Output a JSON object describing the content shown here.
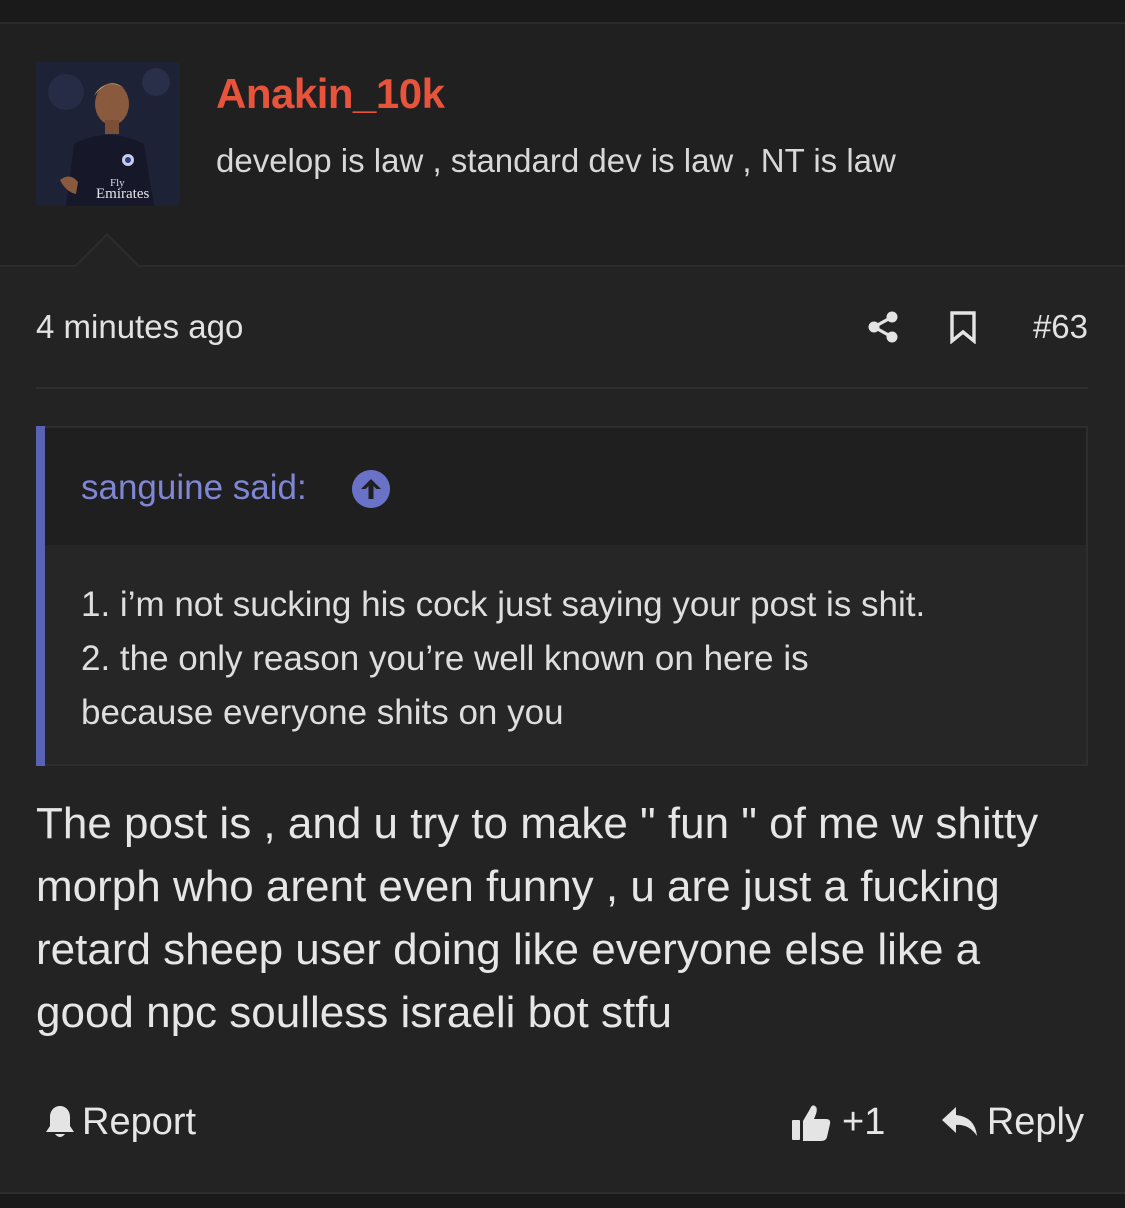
{
  "user": {
    "username": "Anakin_10k",
    "title": "develop is law , standard dev is law , NT is law",
    "avatar_icon": "user-avatar-photo",
    "username_color": "#e8533c"
  },
  "meta": {
    "timestamp": "4 minutes ago",
    "post_number": "#63",
    "share_icon": "share-icon",
    "bookmark_icon": "bookmark-icon"
  },
  "quote": {
    "author": "sanguine said:",
    "jump_icon": "arrow-up-circle-icon",
    "lines": [
      "1. i’m not sucking his cock just saying your post is shit.",
      "2. the only reason you’re well known on here is",
      "because everyone shits on you"
    ],
    "accent_color": "#5a62b4"
  },
  "post": {
    "lines": [
      "The post is , and u try to make \" fun \" of me w shitty",
      "morph who arent even funny , u are just a fucking",
      "retard sheep user doing like everyone else like a",
      "good npc soulless israeli bot stfu"
    ]
  },
  "actions": {
    "report_label": "Report",
    "report_icon": "bell-icon",
    "like_count": "+1",
    "like_icon": "thumbs-up-icon",
    "reply_label": "Reply",
    "reply_icon": "reply-arrow-icon"
  }
}
